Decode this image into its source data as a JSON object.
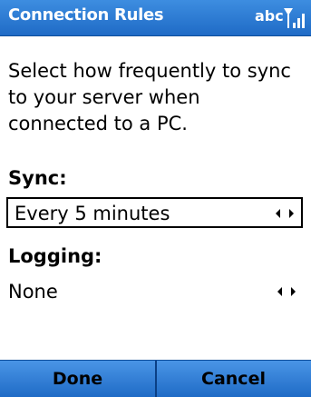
{
  "titlebar": {
    "title": "Connection Rules",
    "input_mode": "abc",
    "signal_icon": "antenna-signal-icon"
  },
  "content": {
    "description": "Select how frequently to sync to your server when connected to a PC.",
    "sync": {
      "label": "Sync:",
      "value": "Every 5 minutes"
    },
    "logging": {
      "label": "Logging:",
      "value": "None"
    }
  },
  "softkeys": {
    "left": "Done",
    "right": "Cancel"
  },
  "colors": {
    "titlebar": "#2a78d4",
    "softbar": "#2a78d4"
  }
}
